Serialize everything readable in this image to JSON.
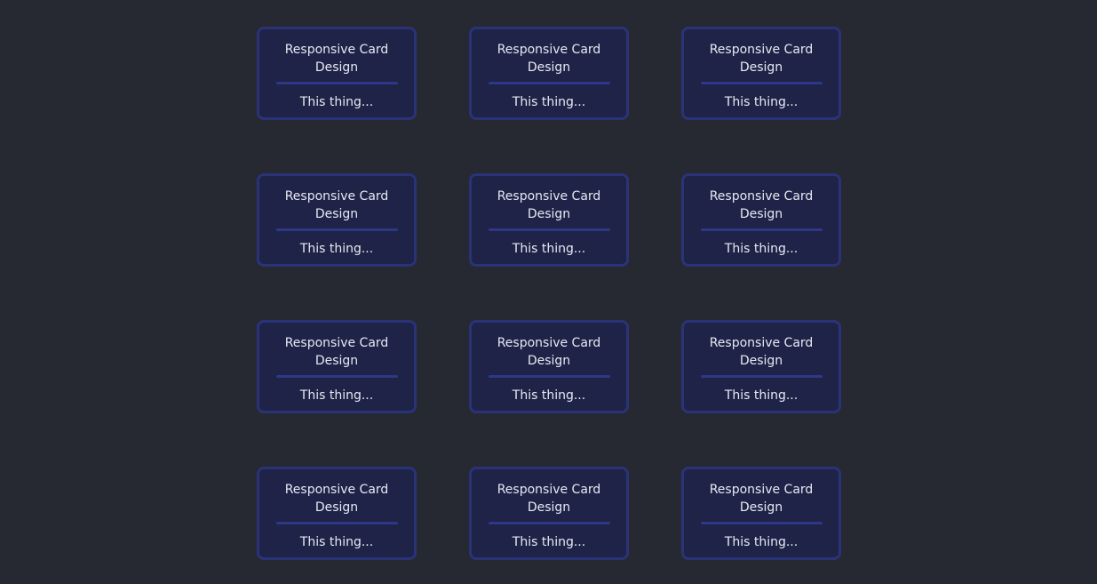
{
  "cards": [
    {
      "title": "Responsive Card Design",
      "body": "This thing..."
    },
    {
      "title": "Responsive Card Design",
      "body": "This thing..."
    },
    {
      "title": "Responsive Card Design",
      "body": "This thing..."
    },
    {
      "title": "Responsive Card Design",
      "body": "This thing..."
    },
    {
      "title": "Responsive Card Design",
      "body": "This thing..."
    },
    {
      "title": "Responsive Card Design",
      "body": "This thing..."
    },
    {
      "title": "Responsive Card Design",
      "body": "This thing..."
    },
    {
      "title": "Responsive Card Design",
      "body": "This thing..."
    },
    {
      "title": "Responsive Card Design",
      "body": "This thing..."
    },
    {
      "title": "Responsive Card Design",
      "body": "This thing..."
    },
    {
      "title": "Responsive Card Design",
      "body": "This thing..."
    },
    {
      "title": "Responsive Card Design",
      "body": "This thing..."
    }
  ],
  "colors": {
    "page_background": "#262932",
    "card_background": "#1e2347",
    "card_border": "#2a3377",
    "divider": "#2f3887",
    "text": "#e7e9f2"
  }
}
